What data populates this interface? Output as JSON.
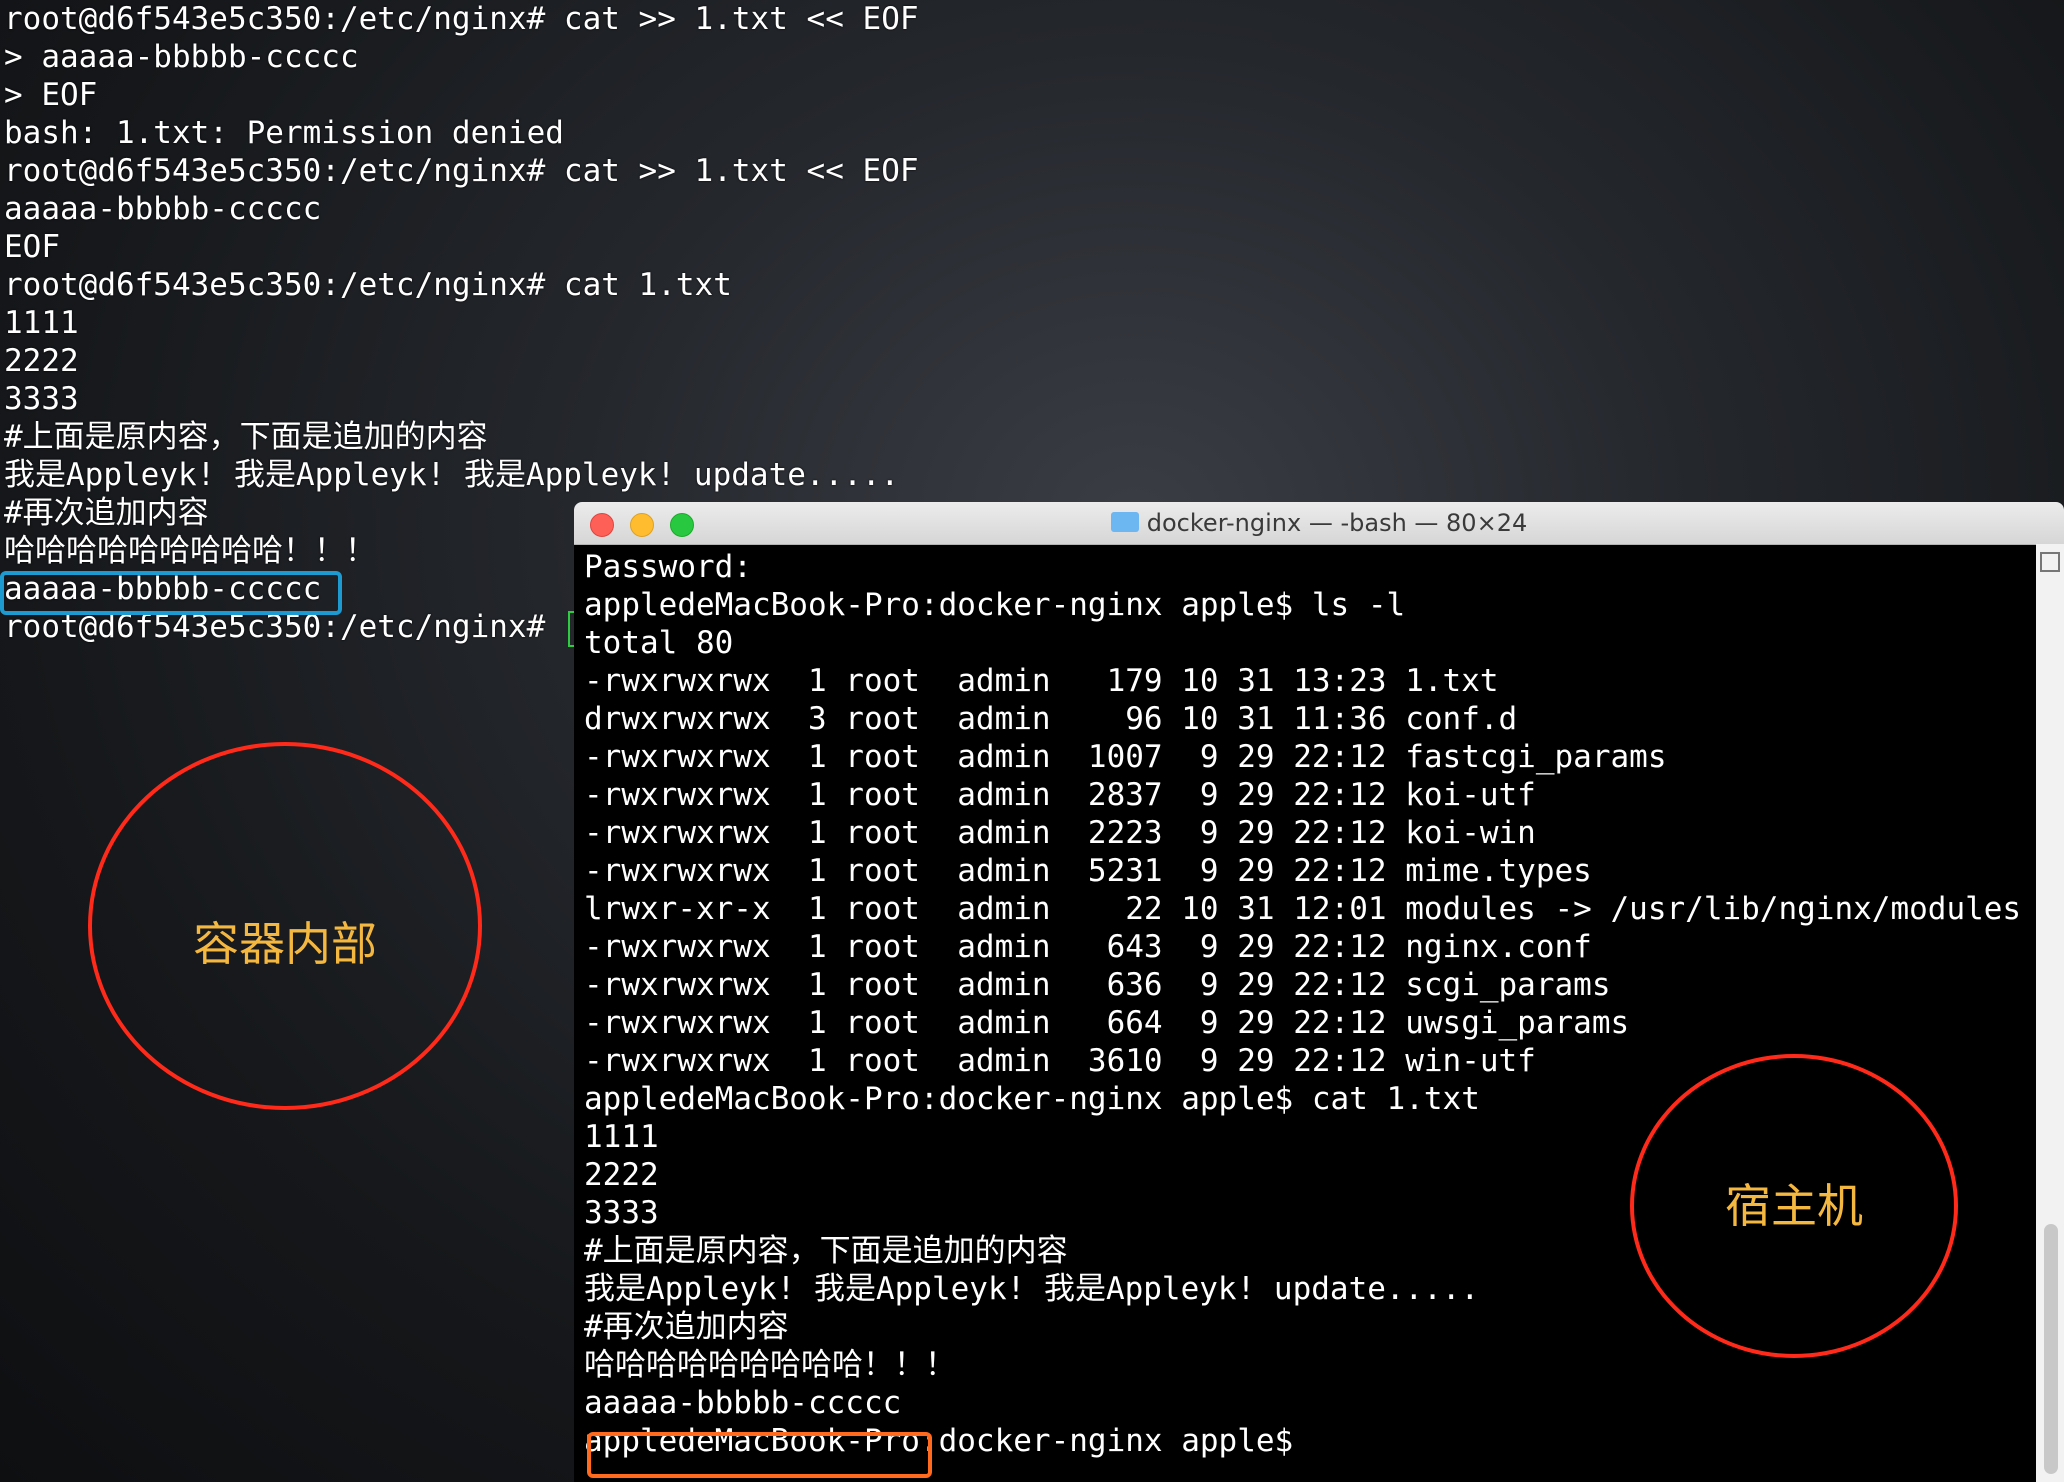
{
  "container_terminal": {
    "lines": [
      "root@d6f543e5c350:/etc/nginx# cat >> 1.txt << EOF",
      "> aaaaa-bbbbb-ccccc",
      "> EOF",
      "bash: 1.txt: Permission denied",
      "root@d6f543e5c350:/etc/nginx# cat >> 1.txt << EOF",
      "aaaaa-bbbbb-ccccc",
      "EOF",
      "root@d6f543e5c350:/etc/nginx# cat 1.txt",
      "1111",
      "2222",
      "3333",
      "#上面是原内容，下面是追加的内容",
      "我是Appleyk! 我是Appleyk! 我是Appleyk! update.....",
      "#再次追加内容",
      "哈哈哈哈哈哈哈哈哈！！！",
      "aaaaa-bbbbb-ccccc",
      "root@d6f543e5c350:/etc/nginx# "
    ]
  },
  "annotations": {
    "container_label": "容器内部",
    "host_label": "宿主机"
  },
  "host_window": {
    "title": "docker-nginx — -bash — 80×24",
    "lines": [
      "Password:",
      "appledeMacBook-Pro:docker-nginx apple$ ls -l",
      "total 80",
      "-rwxrwxrwx  1 root  admin   179 10 31 13:23 1.txt",
      "drwxrwxrwx  3 root  admin    96 10 31 11:36 conf.d",
      "-rwxrwxrwx  1 root  admin  1007  9 29 22:12 fastcgi_params",
      "-rwxrwxrwx  1 root  admin  2837  9 29 22:12 koi-utf",
      "-rwxrwxrwx  1 root  admin  2223  9 29 22:12 koi-win",
      "-rwxrwxrwx  1 root  admin  5231  9 29 22:12 mime.types",
      "lrwxr-xr-x  1 root  admin    22 10 31 12:01 modules -> /usr/lib/nginx/modules",
      "-rwxrwxrwx  1 root  admin   643  9 29 22:12 nginx.conf",
      "-rwxrwxrwx  1 root  admin   636  9 29 22:12 scgi_params",
      "-rwxrwxrwx  1 root  admin   664  9 29 22:12 uwsgi_params",
      "-rwxrwxrwx  1 root  admin  3610  9 29 22:12 win-utf",
      "appledeMacBook-Pro:docker-nginx apple$ cat 1.txt",
      "1111",
      "2222",
      "3333",
      "#上面是原内容，下面是追加的内容",
      "我是Appleyk! 我是Appleyk! 我是Appleyk! update.....",
      "#再次追加内容",
      "哈哈哈哈哈哈哈哈哈！！！",
      "aaaaa-bbbbb-ccccc",
      "appledeMacBook-Pro:docker-nginx apple$"
    ]
  },
  "colors": {
    "circle": "#ff2a1a",
    "label": "#f4b740",
    "highlight_blue": "#1d9bd1",
    "highlight_orange": "#ff6a1e",
    "cursor": "#2ecc40"
  }
}
